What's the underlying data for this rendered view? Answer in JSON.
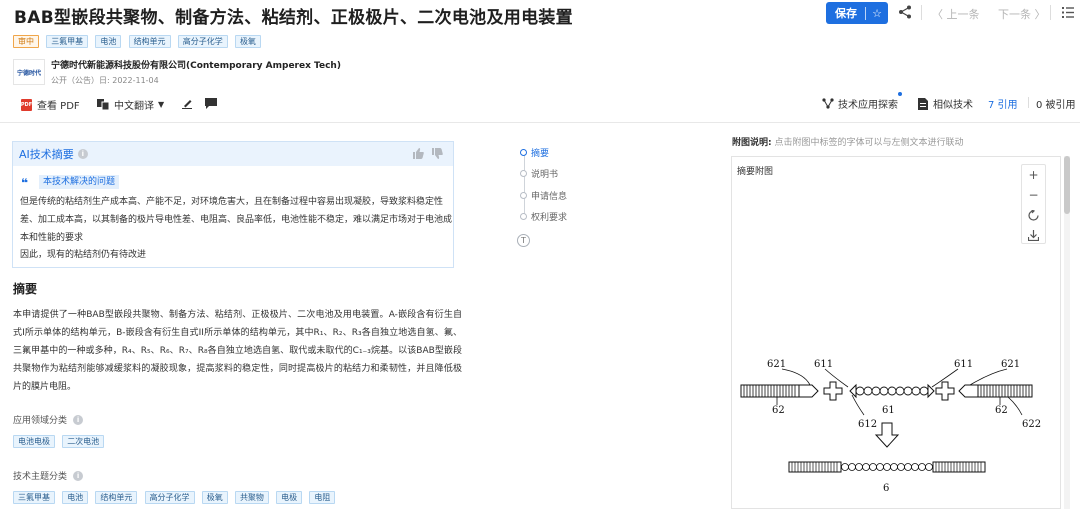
{
  "header": {
    "title": "BAB型嵌段共聚物、制备方法、粘结剂、正极极片、二次电池及用电装置",
    "save_label": "保存",
    "prev_label": "〈 上一条",
    "next_label": "下一条 〉"
  },
  "tags": {
    "status": "审中",
    "items": [
      "三氟甲基",
      "电池",
      "结构单元",
      "高分子化学",
      "极氧"
    ]
  },
  "applicant": {
    "logo_text": "宁德时代",
    "name": "宁德时代新能源科技股份有限公司(Contemporary Amperex Tech)",
    "pub_date": "公开（公告）日: 2022-11-04"
  },
  "toolbar": {
    "pdf_label": "查看 PDF",
    "translate_label": "中文翻译",
    "tech_explore_label": "技术应用探索",
    "similar_label": "相似技术",
    "cite_label": "7 引用",
    "cited_label": "0 被引用"
  },
  "ai_summary": {
    "title": "AI技术摘要",
    "problem_label": "本技术解决的问题",
    "problem_text": "但是传统的粘结剂生产成本高、产能不足，对环境危害大，且在制备过程中容易出现凝胶，导致浆料稳定性差、加工成本高，以其制备的极片导电性差、电阻高、良品率低，电池性能不稳定，难以满足市场对于电池成本和性能的要求",
    "conclusion": "因此，现有的粘结剂仍有待改进"
  },
  "abstract": {
    "heading": "摘要",
    "text": "本申请提供了一种BAB型嵌段共聚物、制备方法、粘结剂、正极极片、二次电池及用电装置。A-嵌段含有衍生自式I所示单体的结构单元，B-嵌段含有衍生自式II所示单体的结构单元，其中R₁、R₂、R₃各自独立地选自氢、氟、三氟甲基中的一种或多种，R₄、R₅、R₆、R₇、R₈各自独立地选自氢、取代或未取代的C₁₋₃烷基。以该BAB型嵌段共聚物作为粘结剂能够减缓浆料的凝胶现象，提高浆料的稳定性，同时提高极片的粘结力和柔韧性，并且降低极片的膜片电阻。"
  },
  "app_field": {
    "label": "应用领域分类",
    "tags": [
      "电池电极",
      "二次电池"
    ]
  },
  "tech_topic": {
    "label": "技术主题分类",
    "tags": [
      "三氟甲基",
      "电池",
      "结构单元",
      "高分子化学",
      "极氧",
      "共聚物",
      "电极",
      "电阻"
    ]
  },
  "outline": {
    "items": [
      "摘要",
      "说明书",
      "申请信息",
      "权利要求"
    ],
    "to_top": "T"
  },
  "figure": {
    "note_label": "附图说明:",
    "note_text": "点击附图中标签的字体可以与左侧文本进行联动",
    "title": "摘要附图",
    "zoom_in": "+",
    "zoom_out": "−",
    "labels": {
      "l621a": "621",
      "l611a": "611",
      "l611b": "611",
      "l621b": "621",
      "l62a": "62",
      "l61": "61",
      "l62b": "62",
      "l612": "612",
      "l622": "622",
      "l6": "6"
    }
  }
}
